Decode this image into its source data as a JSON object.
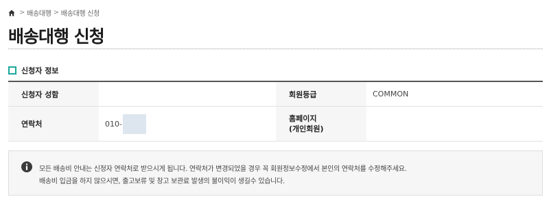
{
  "breadcrumb": {
    "icon": "home-icon",
    "separator": ">",
    "items": [
      "배송대행",
      "배송대행 신청"
    ]
  },
  "page": {
    "title": "배송대행 신청"
  },
  "section": {
    "title": "신청자 정보",
    "icon_color": "#1aa79a"
  },
  "applicant": {
    "name_label": "신청자 성함",
    "name_value": "",
    "grade_label": "회원등급",
    "grade_value": "COMMON",
    "contact_label": "연락처",
    "phone_prefix": "010-",
    "phone_value": "",
    "homepage_label_line1": "홈페이지",
    "homepage_label_line2": "(개인회원)",
    "homepage_value": ""
  },
  "notice": {
    "icon": "info-icon",
    "line1": "모든 배송비 안내는 신청자 연락처로 받으시게 됩니다. 연락처가 변경되었을 경우 꼭 회원정보수정에서 본인의 연락처를 수정해주세요.",
    "line2": "배송비 입금을 하지 않으시면, 출고보류 및 창고 보관료 발생의 불이익이 생길수 있습니다."
  }
}
